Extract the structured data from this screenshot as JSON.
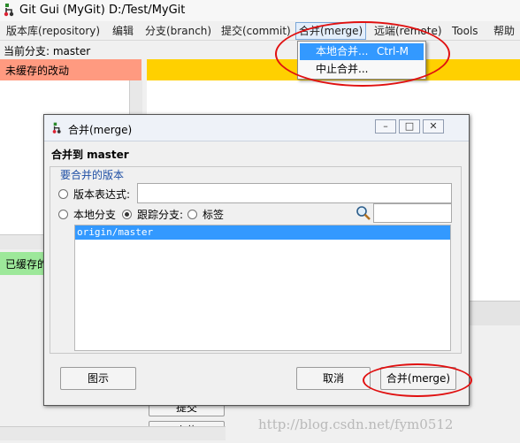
{
  "window": {
    "title": "Git Gui (MyGit) D:/Test/MyGit",
    "icon": "git-logo-icon"
  },
  "menubar": [
    {
      "label": "版本库(repository)",
      "active": false
    },
    {
      "label": "编辑",
      "active": false
    },
    {
      "label": "分支(branch)",
      "active": false
    },
    {
      "label": "提交(commit)",
      "active": false
    },
    {
      "label": "合并(merge)",
      "active": true
    },
    {
      "label": "远端(remote)",
      "active": false
    },
    {
      "label": "Tools",
      "active": false
    },
    {
      "label": "帮助",
      "active": false
    }
  ],
  "merge_menu": {
    "items": [
      {
        "label": "本地合并...",
        "shortcut": "Ctrl-M",
        "highlighted": true
      },
      {
        "label": "中止合并...",
        "shortcut": "",
        "highlighted": false
      }
    ]
  },
  "status": {
    "current_branch": "当前分支: master"
  },
  "panels": {
    "unstaged_label": "未缓存的改动",
    "staged_label": "已缓存的改动",
    "commit_button": "提交",
    "push_button": "上传"
  },
  "colors": {
    "unstaged_header": "#ff9a80",
    "staged_header": "#9de89a",
    "diff_header": "#ffd000",
    "selection": "#3399ff",
    "annotation": "#e01010"
  },
  "dialog": {
    "title": "合并(merge)",
    "heading": "合并到 master",
    "group_title": "要合并的版本",
    "expression_label": "版本表达式:",
    "expression_value": "",
    "source_options": [
      {
        "label": "本地分支",
        "checked": false
      },
      {
        "label": "跟踪分支:",
        "checked": true
      },
      {
        "label": "标签",
        "checked": false
      }
    ],
    "search_icon": "magnifier-icon",
    "filter_value": "",
    "branches": [
      "origin/master"
    ],
    "buttons": {
      "visualize": "图示",
      "cancel": "取消",
      "merge": "合并(merge)"
    }
  },
  "watermark": "http://blog.csdn.net/fym0512"
}
